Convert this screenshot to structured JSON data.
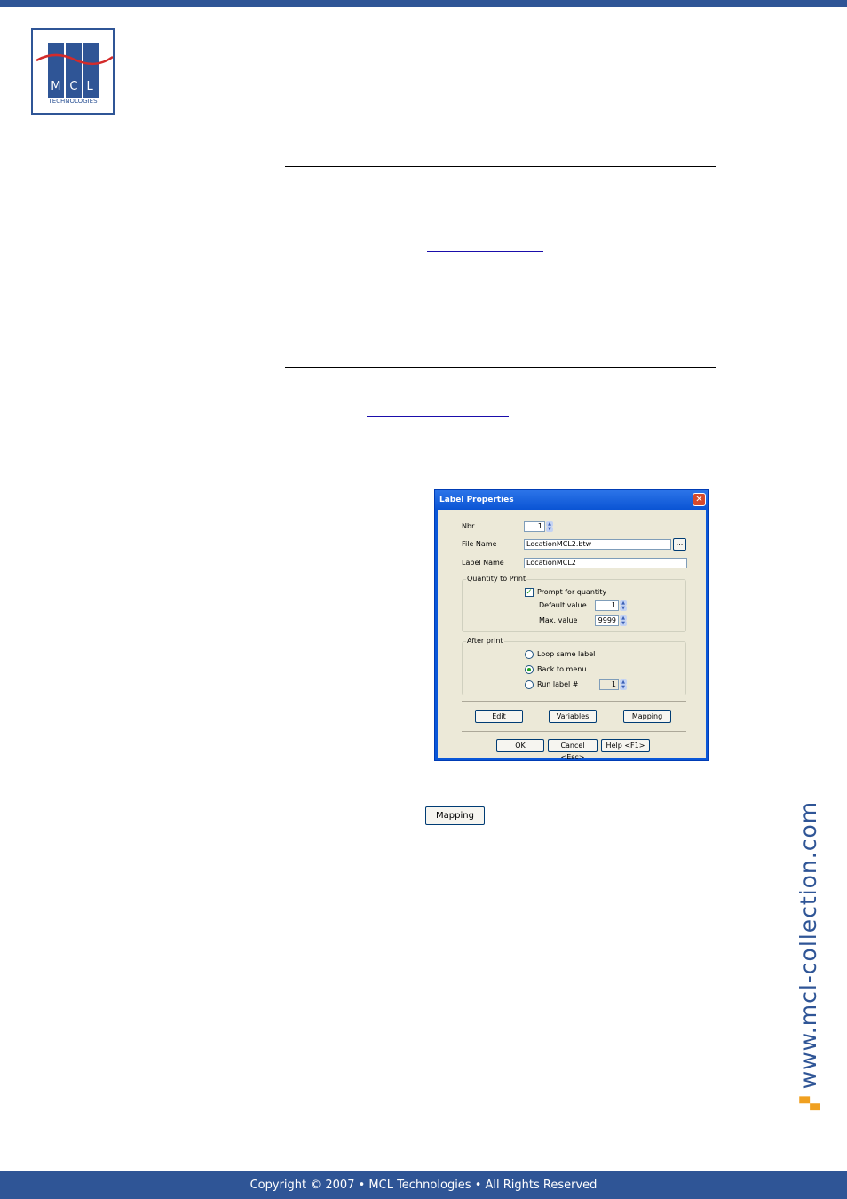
{
  "logo": {
    "letters": "MCL",
    "sub": "TECHNOLOGIES"
  },
  "side_url": "www.mcl-collection.com",
  "footer": "Copyright © 2007 • MCL Technologies • All Rights Reserved",
  "dialog": {
    "title": "Label Properties",
    "close": "✕",
    "nbr_label": "Nbr",
    "nbr_value": "1",
    "file_name_label": "File Name",
    "file_name_value": "LocationMCL2.btw",
    "browse": "...",
    "label_name_label": "Label Name",
    "label_name_value": "LocationMCL2",
    "qty_group": "Quantity to Print",
    "prompt_qty": "Prompt for quantity",
    "prompt_checked": "✓",
    "default_label": "Default value",
    "default_value": "1",
    "max_label": "Max. value",
    "max_value": "9999",
    "after_group": "After print",
    "opt_loop": "Loop same label",
    "opt_back": "Back to menu",
    "opt_run": "Run label #",
    "run_value": "1",
    "btn_edit": "Edit",
    "btn_variables": "Variables",
    "btn_mapping": "Mapping",
    "btn_ok": "OK",
    "btn_cancel": "Cancel <Esc>",
    "btn_help": "Help <F1>"
  },
  "mapping_button": "Mapping"
}
